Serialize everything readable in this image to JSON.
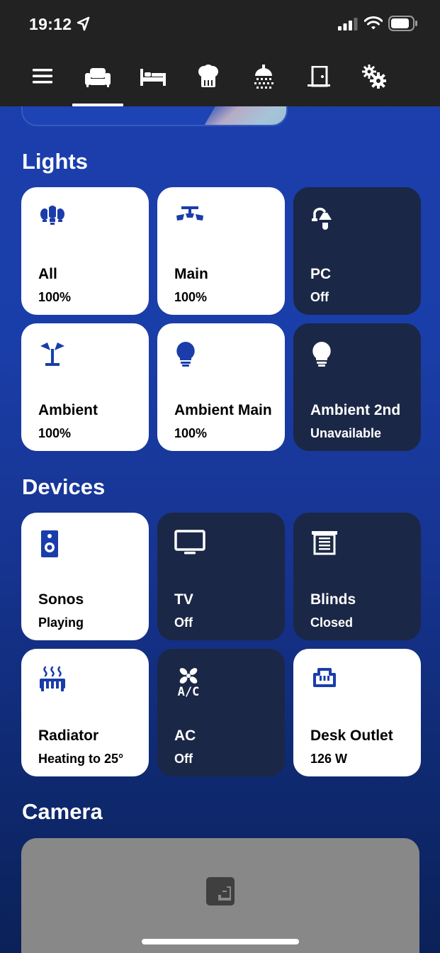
{
  "status_bar": {
    "time": "19:12"
  },
  "nav": {
    "tabs": [
      "menu",
      "living-room",
      "bedroom",
      "kitchen",
      "bathroom",
      "hallway",
      "settings"
    ],
    "active_tab": "living-room"
  },
  "sections": {
    "lights_title": "Lights",
    "devices_title": "Devices",
    "camera_title": "Camera"
  },
  "lights": [
    {
      "name": "All",
      "state": "100%",
      "on": true,
      "icon": "multi-bulb-icon"
    },
    {
      "name": "Main",
      "state": "100%",
      "on": true,
      "icon": "ceiling-light-icon"
    },
    {
      "name": "PC",
      "state": "Off",
      "on": false,
      "icon": "desk-lamp-icon"
    },
    {
      "name": "Ambient",
      "state": "100%",
      "on": true,
      "icon": "floor-lamp-icon"
    },
    {
      "name": "Ambient Main",
      "state": "100%",
      "on": true,
      "icon": "bulb-icon"
    },
    {
      "name": "Ambient 2nd",
      "state": "Unavailable",
      "on": false,
      "icon": "bulb-icon"
    }
  ],
  "devices": [
    {
      "name": "Sonos",
      "state": "Playing",
      "on": true,
      "icon": "speaker-icon"
    },
    {
      "name": "TV",
      "state": "Off",
      "on": false,
      "icon": "tv-icon"
    },
    {
      "name": "Blinds",
      "state": "Closed",
      "on": false,
      "icon": "blinds-icon"
    },
    {
      "name": "Radiator",
      "state": "Heating to 25°",
      "on": true,
      "icon": "radiator-icon"
    },
    {
      "name": "AC",
      "state": "Off",
      "on": false,
      "icon": "ac-icon"
    },
    {
      "name": "Desk Outlet",
      "state": "126 W",
      "on": true,
      "icon": "power-socket-icon"
    }
  ],
  "colors": {
    "accent_blue": "#1c3fae",
    "tile_on": "#ffffff",
    "tile_off": "#1b2746",
    "icon_on": "#1a3dab",
    "topbar": "#222222",
    "camera_placeholder": "#888888"
  }
}
